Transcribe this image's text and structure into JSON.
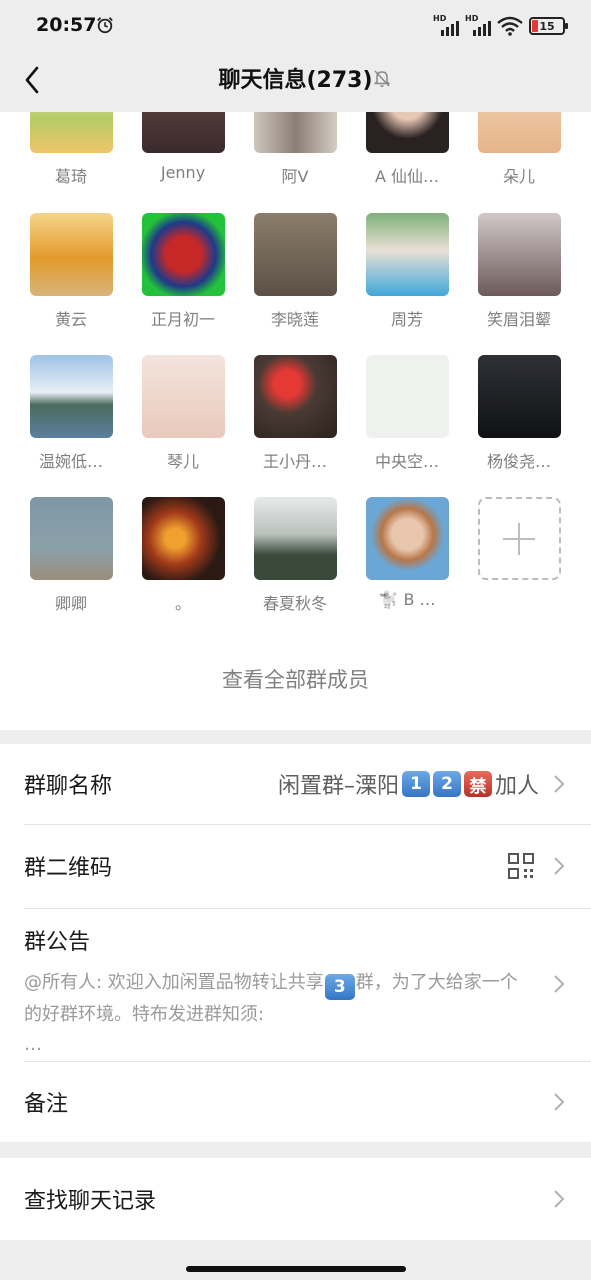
{
  "status_bar": {
    "time": "20:57",
    "signal1_label": "HD",
    "signal2_label": "HD",
    "battery": "15"
  },
  "nav": {
    "title": "聊天信息(273)"
  },
  "members": {
    "names": [
      "葛琦",
      "Jenny",
      "阿V",
      "A 仙仙…",
      "朵儿",
      "黄云",
      "正月初一",
      "李晓莲",
      "周芳",
      "笑眉泪颦",
      "温婉低…",
      "琴儿",
      "王小丹…",
      "中央空…",
      "杨俊尧…",
      "卿卿",
      "。",
      "春夏秋冬",
      "🐩 B …"
    ],
    "view_all": "查看全部群成员"
  },
  "settings": {
    "group_name": {
      "label": "群聊名称",
      "value_prefix": "闲置群–溧阳",
      "badges": [
        "1",
        "2",
        "禁"
      ],
      "value_suffix": "加人"
    },
    "qr_code": {
      "label": "群二维码"
    },
    "notice": {
      "label": "群公告",
      "text_before": "@所有人: 欢迎入加闲置品物转让共享",
      "badge": "3",
      "text_after": "群，为了大给家一个的好群环境。特布发进群知须:",
      "ellipsis": "…"
    },
    "remark": {
      "label": "备注"
    },
    "search_history": {
      "label": "查找聊天记录"
    }
  },
  "icons": [
    "back-arrow-icon",
    "mute-bell-icon",
    "alarm-icon",
    "wifi-icon",
    "battery-icon",
    "add-member-icon",
    "qr-code-icon",
    "chevron-right-icon"
  ]
}
